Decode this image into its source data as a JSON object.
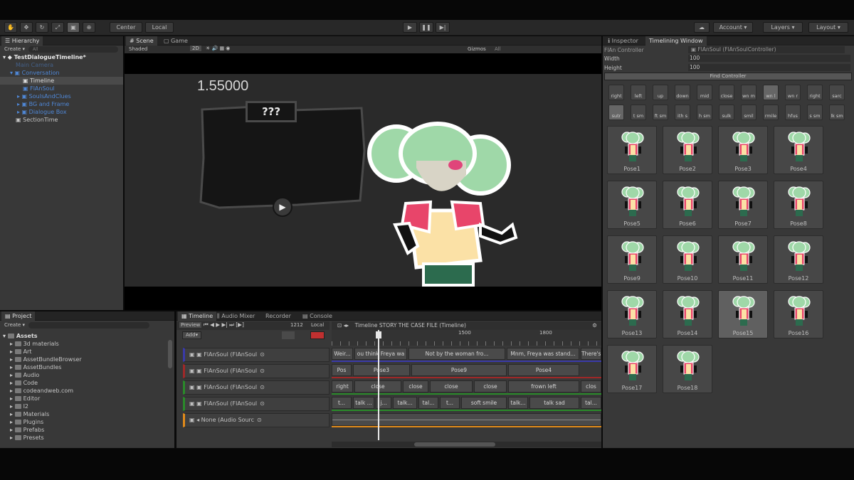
{
  "toolbar": {
    "center": "Center",
    "local": "Local",
    "account": "Account",
    "layers": "Layers",
    "layout": "Layout"
  },
  "hierarchy": {
    "tab": "Hierarchy",
    "create": "Create",
    "search": "All",
    "scene": "TestDialogueTimeline*",
    "items": [
      "Main Camera",
      "Conversation",
      "Timeline",
      "FlAnSoul",
      "SoulsAndClues",
      "BG and Frame",
      "Dialogue Box",
      "SectionTime"
    ]
  },
  "scene": {
    "tab_scene": "Scene",
    "tab_game": "Game",
    "shading": "Shaded",
    "mode2d": "2D",
    "gizmos": "Gizmos",
    "all": "All",
    "time_value": "1.55000",
    "speaker": "???"
  },
  "inspector": {
    "tab_inspector": "Inspector",
    "tab_timelining": "Timelining Window",
    "controller_label": "FlAn Controller",
    "controller_value": "FlAnSoul (FlAnSoulController)",
    "width_label": "Width",
    "width_value": "100",
    "height_label": "Height",
    "height_value": "100",
    "find_button": "Find Controller",
    "expressions_row1": [
      "right",
      "left",
      "up",
      "down",
      "mid",
      "close",
      "wn m",
      "wn l",
      "wn r",
      "right",
      "sarc"
    ],
    "expressions_row2": [
      "sutr",
      "t sm",
      "ft sm",
      "ith s",
      "h sm",
      "sulk",
      "smil",
      "rmile",
      "hfus",
      "s sm",
      "lk sm"
    ],
    "poses": [
      "Pose1",
      "Pose2",
      "Pose3",
      "Pose4",
      "Pose5",
      "Pose6",
      "Pose7",
      "Pose8",
      "Pose9",
      "Pose10",
      "Pose11",
      "Pose12",
      "Pose13",
      "Pose14",
      "Pose15",
      "Pose16",
      "Pose17",
      "Pose18"
    ],
    "selected_pose": "Pose15"
  },
  "project": {
    "tab": "Project",
    "create": "Create",
    "root": "Assets",
    "folders": [
      "3d materials",
      "Art",
      "AssetBundleBrowser",
      "AssetBundles",
      "Audio",
      "Code",
      "codeandweb.com",
      "Editor",
      "I2",
      "Materials",
      "Plugins",
      "Prefabs",
      "Presets"
    ]
  },
  "timeline": {
    "tab_timeline": "Timeline",
    "tab_mixer": "Audio Mixer",
    "tab_recorder": "Recorder",
    "tab_console": "Console",
    "preview": "Preview",
    "frame": "1212",
    "local": "Local",
    "add": "Add",
    "title": "Timeline STORY THE CASE FILE (Timeline)",
    "ruler": [
      "1500",
      "1800"
    ],
    "tracks": [
      "FlAnSoul (FlAnSoul",
      "FlAnSoul (FlAnSoul",
      "FlAnSoul (FlAnSoul",
      "FlAnSoul (FlAnSoul",
      "None (Audio Sourc"
    ],
    "row1": [
      "Weir...",
      "ou think Freya wa",
      "Not by the woman fro...",
      "Mnm, Freya was stand...",
      "There's"
    ],
    "row2": [
      "Pos",
      "Pose3",
      "Pose9",
      "Pose4"
    ],
    "row3": [
      "right",
      "close",
      "close",
      "close",
      "close",
      "frown left",
      "clos"
    ],
    "row4": [
      "t...",
      "talk ...",
      "j...",
      "talk...",
      "tal...",
      "t...",
      "soft smile",
      "talk...",
      "talk sad",
      "tal..."
    ]
  }
}
